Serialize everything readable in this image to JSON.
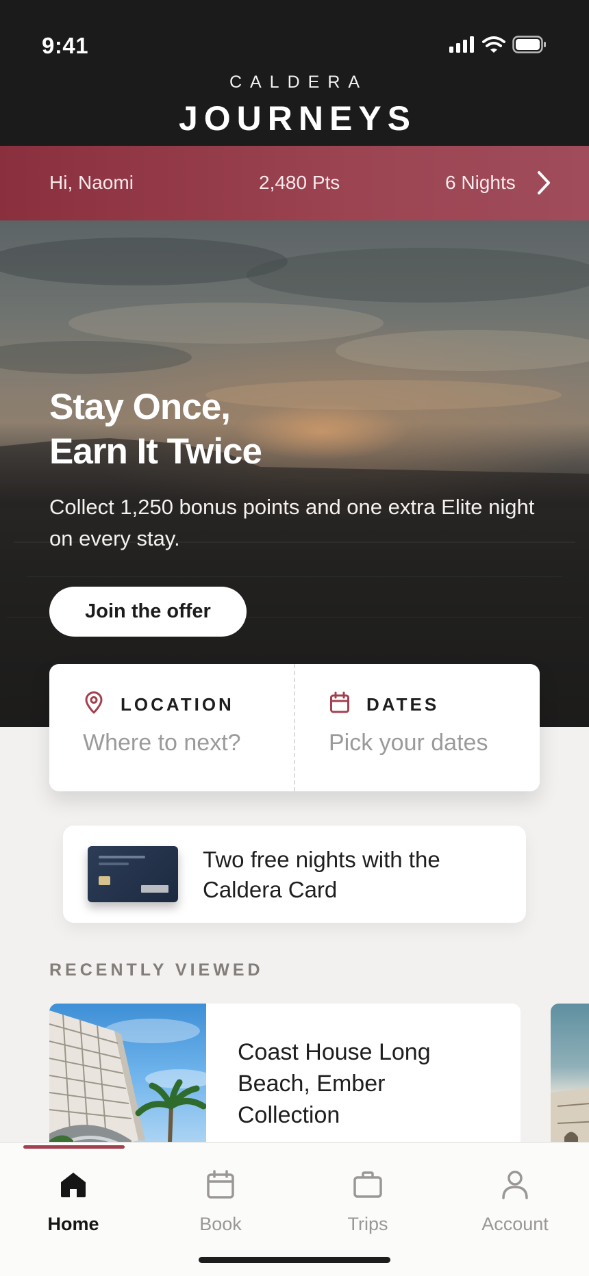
{
  "status_bar": {
    "time": "9:41"
  },
  "header": {
    "brand_top": "CALDERA",
    "brand_main": "JOURNEYS"
  },
  "member": {
    "greeting": "Hi, Naomi",
    "points": "2,480 Pts",
    "nights": "6 Nights"
  },
  "hero": {
    "title_line1": "Stay Once,",
    "title_line2": "Earn It Twice",
    "subtitle": "Collect 1,250 bonus points and one extra Elite night on every stay.",
    "cta_label": "Join the offer"
  },
  "search": {
    "location_label": "LOCATION",
    "location_placeholder": "Where to next?",
    "dates_label": "DATES",
    "dates_placeholder": "Pick your dates"
  },
  "promo": {
    "text": "Two free nights with the Caldera Card"
  },
  "recently_viewed": {
    "section_title": "RECENTLY VIEWED",
    "items": [
      {
        "name": "Coast House Long Beach, Ember Collection"
      }
    ]
  },
  "tabs": [
    {
      "label": "Home",
      "icon": "home-icon",
      "active": true
    },
    {
      "label": "Book",
      "icon": "calendar-icon",
      "active": false
    },
    {
      "label": "Trips",
      "icon": "briefcase-icon",
      "active": false
    },
    {
      "label": "Account",
      "icon": "person-icon",
      "active": false
    }
  ],
  "colors": {
    "accent": "#a2404f",
    "header_bg": "#1c1b1b",
    "member_bar": "#9c4452"
  }
}
